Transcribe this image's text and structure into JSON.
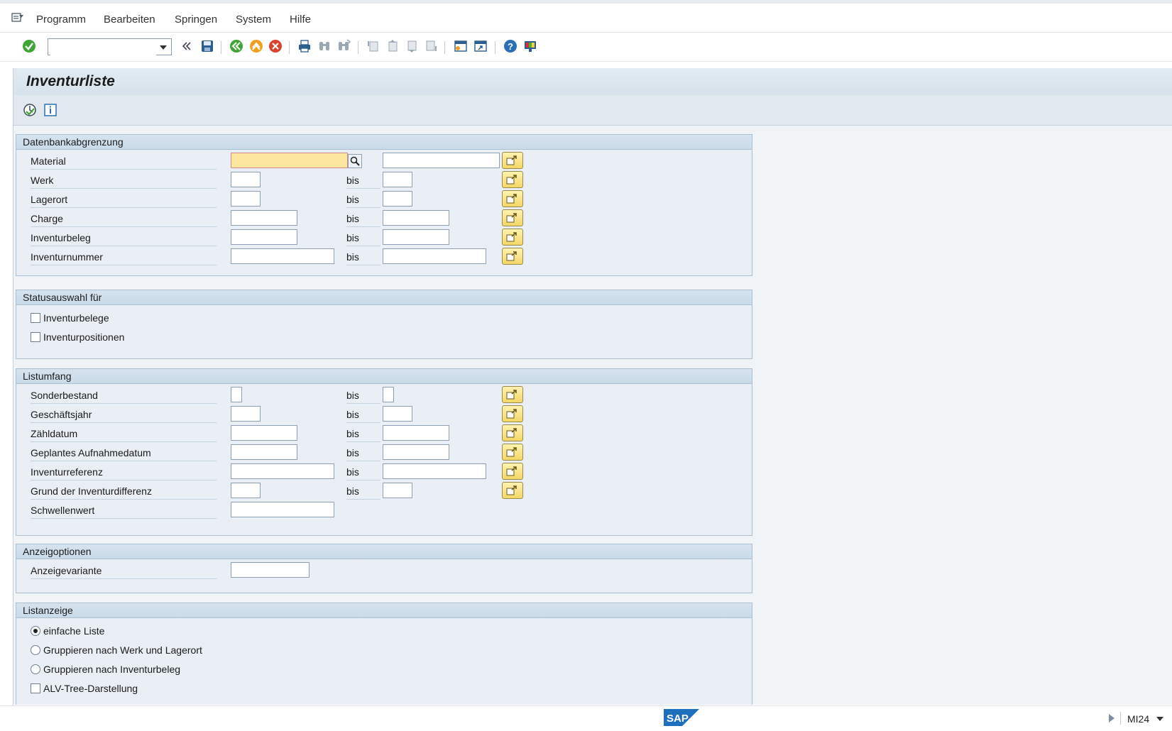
{
  "menu": {
    "items": [
      {
        "label": "Programm"
      },
      {
        "label": "Bearbeiten"
      },
      {
        "label": "Springen"
      },
      {
        "label": "System"
      },
      {
        "label": "Hilfe"
      }
    ]
  },
  "toolbar": {
    "command_value": "",
    "icons": [
      "enter-icon",
      "command-dropdown-icon",
      "collapse-icon",
      "save-icon",
      "back-icon",
      "exit-icon",
      "cancel-icon",
      "print-icon",
      "find-icon",
      "find-next-icon",
      "first-page-icon",
      "previous-page-icon",
      "next-page-icon",
      "last-page-icon",
      "create-session-icon",
      "shortcut-icon",
      "help-icon",
      "customize-layout-icon"
    ]
  },
  "title": "Inventurliste",
  "app_toolbar": {
    "icons": [
      "execute-icon",
      "info-icon"
    ]
  },
  "groups": {
    "db": {
      "header": "Datenbankabgrenzung",
      "rows": [
        {
          "label": "Material"
        },
        {
          "label": "Werk",
          "bis": "bis"
        },
        {
          "label": "Lagerort",
          "bis": "bis"
        },
        {
          "label": "Charge",
          "bis": "bis"
        },
        {
          "label": "Inventurbeleg",
          "bis": "bis"
        },
        {
          "label": "Inventurnummer",
          "bis": "bis"
        }
      ]
    },
    "status": {
      "header": "Statusauswahl für",
      "options": [
        {
          "label": "Inventurbelege",
          "checked": false
        },
        {
          "label": "Inventurpositionen",
          "checked": false
        }
      ]
    },
    "listumfang": {
      "header": "Listumfang",
      "rows": [
        {
          "label": "Sonderbestand",
          "bis": "bis"
        },
        {
          "label": "Geschäftsjahr",
          "bis": "bis"
        },
        {
          "label": "Zähldatum",
          "bis": "bis"
        },
        {
          "label": "Geplantes Aufnahmedatum",
          "bis": "bis"
        },
        {
          "label": "Inventurreferenz",
          "bis": "bis"
        },
        {
          "label": "Grund der Inventurdifferenz",
          "bis": "bis"
        },
        {
          "label": "Schwellenwert"
        }
      ]
    },
    "anzeige": {
      "header": "Anzeigoptionen",
      "rows": [
        {
          "label": "Anzeigevariante"
        }
      ]
    },
    "listanzeige": {
      "header": "Listanzeige",
      "options": [
        {
          "label": "einfache Liste",
          "selected": true
        },
        {
          "label": "Gruppieren nach Werk und Lagerort",
          "selected": false
        },
        {
          "label": "Gruppieren nach Inventurbeleg",
          "selected": false
        },
        {
          "label": "ALV-Tree-Darstellung",
          "checked": false
        }
      ]
    }
  },
  "statusbar": {
    "logo": "SAP",
    "tcode": "MI24"
  },
  "colors": {
    "focus_field": "#fbe7a0",
    "multi_button": "#f3d766",
    "group_header": "#c9dae9",
    "sap_blue": "#1f6fbf"
  }
}
